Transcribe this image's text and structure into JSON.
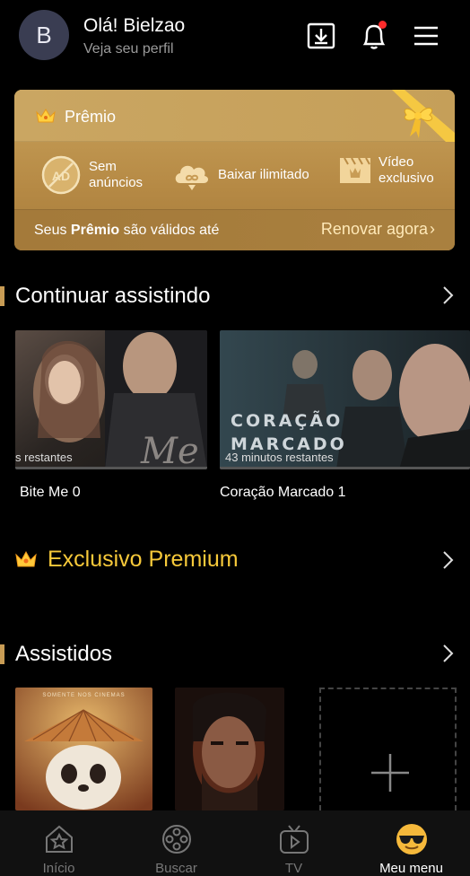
{
  "header": {
    "avatar_letter": "B",
    "greeting": "Olá! Bielzao",
    "profile_link": "Veja seu perfil"
  },
  "premium": {
    "title": "Prêmio",
    "features": [
      {
        "icon": "ad-block-icon",
        "label_line1": "Sem",
        "label_line2": "anúncios"
      },
      {
        "icon": "cloud-download-icon",
        "label_line1": "Baixar ilimitado",
        "label_line2": ""
      },
      {
        "icon": "video-clapper-icon",
        "label_line1": "Vídeo",
        "label_line2": "exclusivo"
      }
    ],
    "valid_prefix": "Seus ",
    "valid_bold": "Prêmio",
    "valid_suffix": " são válidos até",
    "renew_label": "Renovar agora"
  },
  "continue_watching": {
    "title": "Continuar assistindo",
    "items": [
      {
        "title": "Bite Me 0",
        "remaining": "s restantes"
      },
      {
        "title": "Coração Marcado 1",
        "remaining": "43 minutos restantes",
        "poster_text_1": "CORAÇÃO",
        "poster_text_2": "MARCADO"
      }
    ]
  },
  "exclusive": {
    "title": "Exclusivo Premium"
  },
  "watched": {
    "title": "Assistidos",
    "poster_caption": "SOMENTE NOS CINEMAS"
  },
  "bottom_nav": {
    "items": [
      {
        "label": "Início",
        "icon": "home-icon"
      },
      {
        "label": "Buscar",
        "icon": "film-reel-icon"
      },
      {
        "label": "TV",
        "icon": "tv-icon"
      },
      {
        "label": "Meu menu",
        "icon": "sunglasses-emoji-icon"
      }
    ]
  },
  "colors": {
    "gold": "#c89c55",
    "premium_yellow": "#f7c93a",
    "background": "#000000"
  }
}
